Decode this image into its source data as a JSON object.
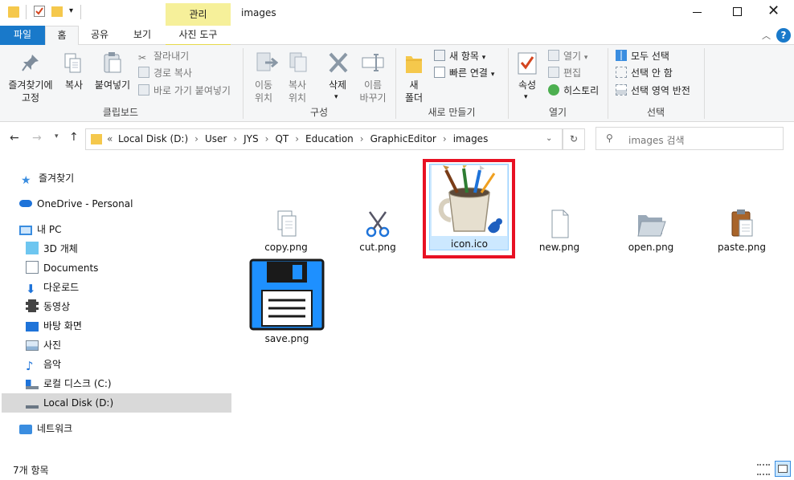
{
  "window": {
    "title": "images",
    "contextual_group": "관리"
  },
  "tabs": [
    {
      "label": "파일"
    },
    {
      "label": "홈"
    },
    {
      "label": "공유"
    },
    {
      "label": "보기"
    },
    {
      "label": "사진 도구"
    }
  ],
  "ribbon": {
    "clipboard": {
      "label": "클립보드",
      "pin": "즐겨찾기에\n고정",
      "copy": "복사",
      "paste": "붙여넣기",
      "cut": "잘라내기",
      "copy_path": "경로 복사",
      "paste_shortcut": "바로 가기 붙여넣기"
    },
    "organize": {
      "label": "구성",
      "move": "이동\n위치",
      "copy_to": "복사\n위치",
      "delete": "삭제",
      "rename": "이름\n바꾸기"
    },
    "new": {
      "label": "새로 만들기",
      "new_folder": "새\n폴더",
      "new_item": "새 항목",
      "easy_access": "빠른 연결"
    },
    "open": {
      "label": "열기",
      "properties": "속성",
      "open": "열기",
      "edit": "편집",
      "history": "히스토리"
    },
    "select": {
      "label": "선택",
      "select_all": "모두 선택",
      "select_none": "선택 안 함",
      "invert": "선택 영역 반전"
    }
  },
  "address": {
    "overflow": "«",
    "crumbs": [
      "Local Disk (D:)",
      "User",
      "JYS",
      "QT",
      "Education",
      "GraphicEditor",
      "images"
    ],
    "search_placeholder": "images 검색"
  },
  "nav": {
    "quick_access": "즐겨찾기",
    "onedrive": "OneDrive - Personal",
    "this_pc": "내 PC",
    "items": [
      "3D 개체",
      "Documents",
      "다운로드",
      "동영상",
      "바탕 화면",
      "사진",
      "음악",
      "로컬 디스크 (C:)",
      "Local Disk (D:)"
    ],
    "network": "네트워크"
  },
  "files": [
    {
      "name": "copy.png"
    },
    {
      "name": "cut.png"
    },
    {
      "name": "icon.ico"
    },
    {
      "name": "new.png"
    },
    {
      "name": "open.png"
    },
    {
      "name": "paste.png"
    },
    {
      "name": "save.png"
    }
  ],
  "status": {
    "count": "7개 항목"
  },
  "colors": {
    "accent": "#1979ca",
    "highlight": "#e81123",
    "contextual": "#f6f09a",
    "selected_nav": "#cce8ff"
  }
}
